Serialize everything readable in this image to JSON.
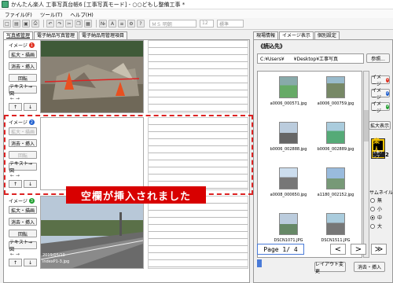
{
  "window": {
    "title": "かんたん楽人 工事写真台帳6 [工事写真モード] - ○○どもし整備工事 *"
  },
  "menu": [
    "ファイル(F)",
    "ツール(T)",
    "ヘルプ(H)"
  ],
  "toolbar": {
    "font": "ＭＳ 明朝",
    "size": "12",
    "style": "標準"
  },
  "left_tabs": [
    "写真帳管理",
    "電子納品写真管理",
    "電子納品用管理項目"
  ],
  "rows": [
    {
      "image_label": "イメージ",
      "image_num": "1",
      "dot_color": "#e03020",
      "buttons": [
        "拡大・描画",
        "消去・挿入",
        "回転",
        "テキスト→図"
      ]
    },
    {
      "image_label": "イメージ",
      "image_num": "2",
      "dot_color": "#2060d0",
      "buttons": [
        "拡大・描画",
        "消去・挿入",
        "回転",
        "テキスト→図"
      ]
    },
    {
      "image_label": "イメージ",
      "image_num": "3",
      "dot_color": "#20a030",
      "buttons": [
        "拡大・描画",
        "消去・挿入",
        "回転",
        "テキスト→図"
      ],
      "stamp_date": "2019/05/10",
      "stamp_name": "indexP1-3.jpg"
    }
  ],
  "banner": "空欄が挿入されました",
  "right_tabs": [
    "現場情報",
    "イメージ表示",
    "個別設定"
  ],
  "read_title": "《読込先》",
  "path": "C:¥Users¥　　¥Desktop¥工事写真",
  "browse": "参照...",
  "thumbs": [
    "a0006_000571.jpg",
    "a0006_000759.jpg",
    "b0006_002888.jpg",
    "b0006_002889.jpg",
    "a0008_000650.jpg",
    "a1180_002152.jpg",
    "DSCN1071.JPG",
    "DSCN1511.JPG"
  ],
  "side_buttons": [
    {
      "label": "イメージ",
      "num": "1",
      "color": "#e03020"
    },
    {
      "label": "イメージ",
      "num": "2",
      "color": "#2060d0"
    },
    {
      "label": "イメージ",
      "num": "3",
      "color": "#20a030"
    }
  ],
  "expand_label": "拡大表示",
  "sign": {
    "mark": "楽人",
    "label": "工事テンプ",
    "num": "2"
  },
  "thumb_size": {
    "label": "サムネイル",
    "options": [
      "無",
      "小",
      "中",
      "大"
    ],
    "selected": "中"
  },
  "pager": {
    "page": "Page 1/ 4",
    "prev": "<",
    "next": ">",
    "last": "≫"
  },
  "layout_change": "レイアウト変更",
  "erase_insert": "消去・挿入"
}
